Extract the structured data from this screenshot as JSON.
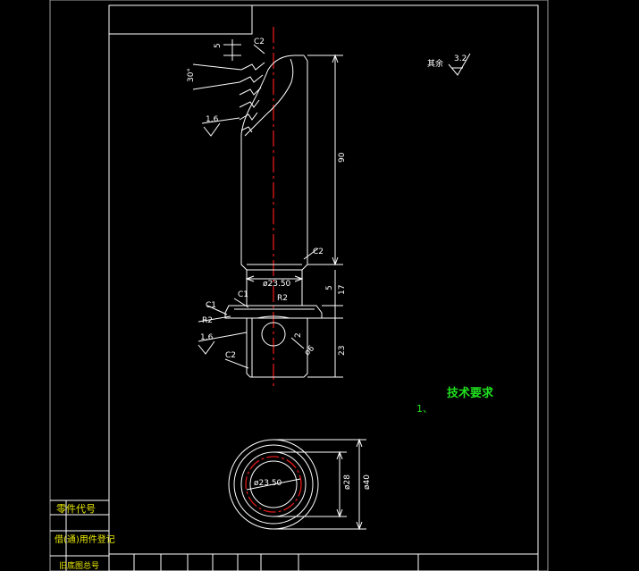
{
  "drawing": {
    "colors": {
      "background": "#000000",
      "lines": "#ffffff",
      "centerline": "#e01818",
      "title_text": "#20e020",
      "table_text": "#e8e800"
    },
    "dimensions": {
      "chamfer_top": "C2",
      "thread_pitch": "5",
      "thread_angle": "30°",
      "roughness_thread": "1.6",
      "length_shaft": "90",
      "chamfer_shaft": "C2",
      "dia_shaft": "ø23.50",
      "chamfer_c1a": "C1",
      "chamfer_c1b": "C1",
      "radius_r2a": "R2",
      "radius_r2b": "R2",
      "dim_5": "5",
      "dim_17": "17",
      "dim_2": "2",
      "roughness_base": "1.6",
      "chamfer_base": "C2",
      "hole_dia": "ø6",
      "dim_23": "23",
      "dia_inner": "ø23.50",
      "dia_28": "ø28",
      "dia_40": "ø40"
    },
    "roughness_note": {
      "label": "其余",
      "value": "3.2"
    },
    "tech_requirements": {
      "title": "技术要求",
      "item1": "1、"
    },
    "side_table": {
      "row1": "零件代号",
      "row2": "借(通)用件登记",
      "row3": "旧底图总号"
    }
  }
}
